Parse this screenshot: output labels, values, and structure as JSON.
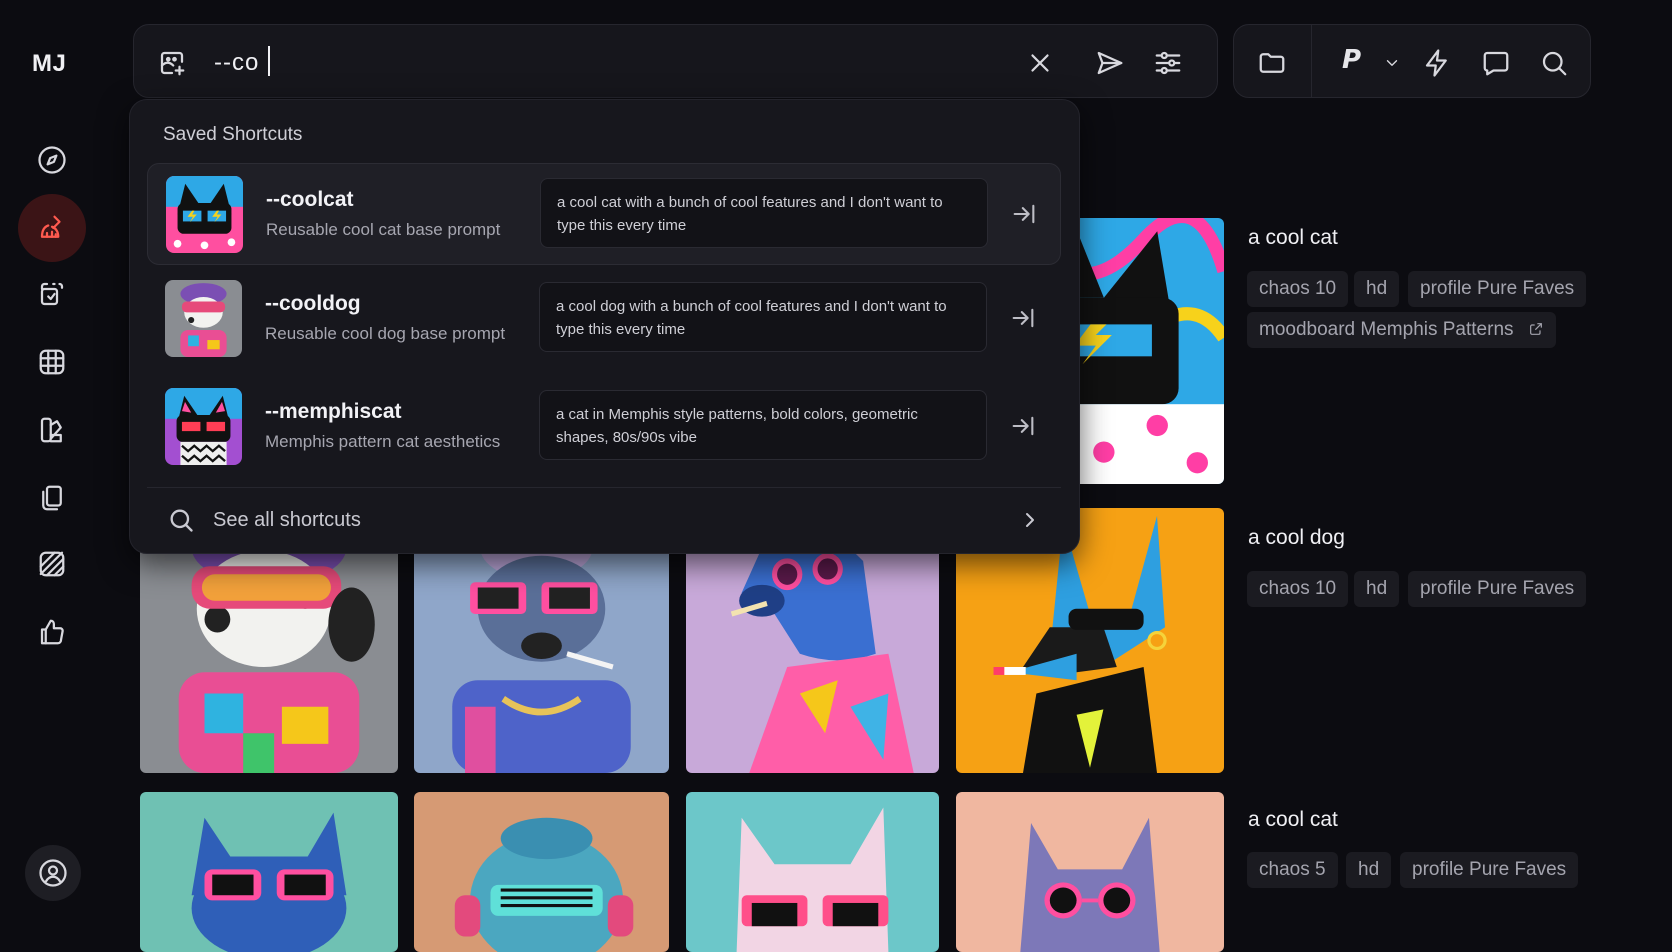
{
  "app": {
    "logo": "MJ"
  },
  "sidebar": {
    "items": [
      {
        "name": "explore",
        "icon": "compass-icon"
      },
      {
        "name": "create",
        "icon": "brush-icon",
        "active": true
      },
      {
        "name": "edit",
        "icon": "edit-image-icon"
      },
      {
        "name": "organize",
        "icon": "grid-icon"
      },
      {
        "name": "personalize",
        "icon": "palette-icon"
      },
      {
        "name": "moodboards",
        "icon": "stack-icon"
      },
      {
        "name": "patterns",
        "icon": "pattern-icon"
      },
      {
        "name": "rank",
        "icon": "thumbs-up-icon"
      }
    ],
    "account_icon": "user-circle-icon"
  },
  "search": {
    "value": "--co",
    "icons": [
      "image-prompt-icon",
      "clear-icon",
      "send-icon",
      "settings-sliders-icon"
    ]
  },
  "toolbar": {
    "personalize_label": "P",
    "icons": [
      "folder-icon",
      "chevron-down-icon",
      "lightning-icon",
      "chat-icon",
      "search-icon"
    ]
  },
  "dropdown": {
    "title": "Saved Shortcuts",
    "shortcuts": [
      {
        "name": "--coolcat",
        "description": "Reusable cool cat base prompt",
        "prompt": "a cool cat with a bunch of cool features and I don't want to type this every time"
      },
      {
        "name": "--cooldog",
        "description": "Reusable cool dog base prompt",
        "prompt": "a cool dog with a bunch of cool features and I don't want to type this every time"
      },
      {
        "name": "--memphiscat",
        "description": "Memphis pattern cat aesthetics",
        "prompt": "a cat in Memphis style patterns, bold colors, geometric shapes, 80s/90s vibe"
      }
    ],
    "see_all": "See all shortcuts"
  },
  "groups": [
    {
      "title": "a cool cat",
      "tags": [
        "chaos 10",
        "hd",
        "profile Pure Faves",
        "moodboard Memphis Patterns"
      ]
    },
    {
      "title": "a cool dog",
      "tags": [
        "chaos 10",
        "hd",
        "profile Pure Faves"
      ]
    },
    {
      "title": "a cool cat",
      "tags": [
        "chaos 5",
        "hd",
        "profile Pure Faves"
      ]
    }
  ],
  "colors": {
    "background": "#0c0c11",
    "panel": "#16161c",
    "accent": "#ff5a4f",
    "accent_bg": "#3b1416",
    "tag_bg": "#1b1b21"
  }
}
